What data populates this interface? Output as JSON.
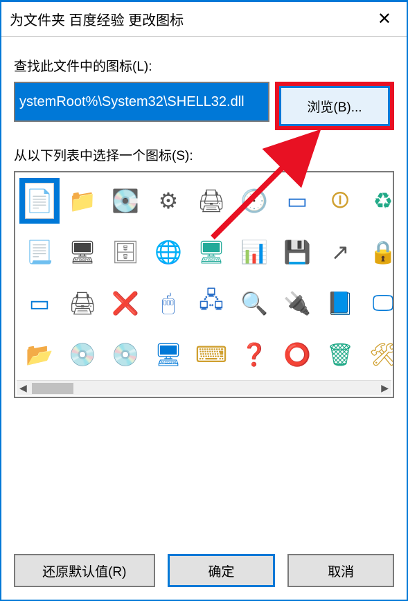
{
  "titlebar": {
    "title": "为文件夹 百度经验 更改图标"
  },
  "labels": {
    "find_in_file": "查找此文件中的图标(L):",
    "select_from_list": "从以下列表中选择一个图标(S):"
  },
  "path_input": {
    "value": "ystemRoot%\\System32\\SHELL32.dll"
  },
  "buttons": {
    "browse": "浏览(B)...",
    "restore": "还原默认值(R)",
    "ok": "确定",
    "cancel": "取消"
  },
  "icons": [
    {
      "name": "blank-document-icon",
      "glyph": "📄",
      "selected": true,
      "color": "#fff"
    },
    {
      "name": "folder-icon",
      "glyph": "📁",
      "color": "#f0c040"
    },
    {
      "name": "drive-icon",
      "glyph": "💽",
      "color": "#888"
    },
    {
      "name": "chip-icon",
      "glyph": "⚙",
      "color": "#555"
    },
    {
      "name": "printer-icon",
      "glyph": "🖨",
      "color": "#555"
    },
    {
      "name": "recent-icon",
      "glyph": "🕘",
      "color": "#888"
    },
    {
      "name": "run-icon",
      "glyph": "▭",
      "color": "#1e6fd0"
    },
    {
      "name": "shutdown-icon",
      "glyph": "⏼",
      "color": "#d0a030"
    },
    {
      "name": "recycle-icon",
      "glyph": "♻",
      "color": "#2a8"
    },
    {
      "name": "document-text-icon",
      "glyph": "📃",
      "color": "#5080c0"
    },
    {
      "name": "computer-icon",
      "glyph": "🖥",
      "color": "#444"
    },
    {
      "name": "drive-stack-icon",
      "glyph": "🗄",
      "color": "#888"
    },
    {
      "name": "globe-ie-icon",
      "glyph": "🌐",
      "color": "#2a6fc8"
    },
    {
      "name": "screen-globe-icon",
      "glyph": "🖥",
      "color": "#2a9"
    },
    {
      "name": "screen-chart-icon",
      "glyph": "📊",
      "color": "#2a6fc8"
    },
    {
      "name": "floppy-icon",
      "glyph": "💾",
      "color": "#c05030"
    },
    {
      "name": "program-shortcut-icon",
      "glyph": "↗",
      "color": "#555"
    },
    {
      "name": "lock-icon",
      "glyph": "🔒",
      "color": "#d0a030"
    },
    {
      "name": "window-icon",
      "glyph": "▭",
      "color": "#0078d7"
    },
    {
      "name": "printer-2-icon",
      "glyph": "🖨",
      "color": "#555"
    },
    {
      "name": "drive-delete-icon",
      "glyph": "❌",
      "color": "#c03030"
    },
    {
      "name": "globe-mouse-icon",
      "glyph": "🖱",
      "color": "#2a6fc8"
    },
    {
      "name": "network-computers-icon",
      "glyph": "🖧",
      "color": "#2a6fc8"
    },
    {
      "name": "search-icon",
      "glyph": "🔍",
      "color": "#888"
    },
    {
      "name": "usb-drive-icon",
      "glyph": "🔌",
      "color": "#2a8"
    },
    {
      "name": "file-blue-icon",
      "glyph": "📘",
      "color": "#2a6fc8"
    },
    {
      "name": "monitor-icon",
      "glyph": "🖵",
      "color": "#0078d7"
    },
    {
      "name": "folder-closed-icon",
      "glyph": "📂",
      "color": "#f0c040"
    },
    {
      "name": "cd-drive-icon",
      "glyph": "💿",
      "color": "#888"
    },
    {
      "name": "cd-icon",
      "glyph": "💿",
      "color": "#888"
    },
    {
      "name": "widescreen-icon",
      "glyph": "🖥",
      "color": "#0078d7"
    },
    {
      "name": "keypad-icon",
      "glyph": "⌨",
      "color": "#d0a030"
    },
    {
      "name": "help-icon",
      "glyph": "❓",
      "color": "#2a6fc8"
    },
    {
      "name": "power-off-icon",
      "glyph": "⭕",
      "color": "#c03030"
    },
    {
      "name": "recycle-bin-icon",
      "glyph": "🗑",
      "color": "#2a8"
    },
    {
      "name": "tools-icon",
      "glyph": "🛠",
      "color": "#d0a030"
    }
  ]
}
